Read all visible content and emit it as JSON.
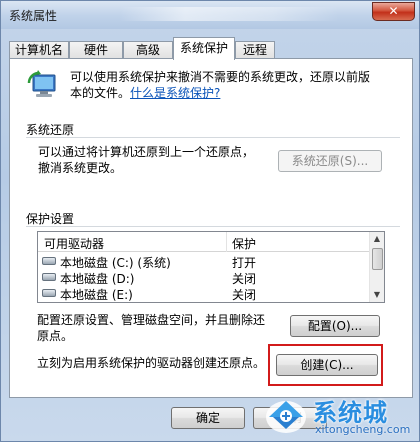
{
  "window": {
    "title": "系统属性",
    "close_label": "✕"
  },
  "tabs": [
    {
      "label": "计算机名"
    },
    {
      "label": "硬件"
    },
    {
      "label": "高级"
    },
    {
      "label": "系统保护"
    },
    {
      "label": "远程"
    }
  ],
  "intro": {
    "text_line1": "可以使用系统保护来撤消不需要的系统更改，还原以前版",
    "text_line2_prefix": "本的文件。",
    "link": "什么是系统保护?"
  },
  "restore": {
    "group_title": "系统还原",
    "desc_line1": "可以通过将计算机还原到上一个还原点，",
    "desc_line2": "撤消系统更改。",
    "button": "系统还原(S)..."
  },
  "protection": {
    "group_title": "保护设置",
    "columns": [
      "可用驱动器",
      "保护"
    ],
    "rows": [
      {
        "drive": "本地磁盘 (C:) (系统)",
        "protection": "打开"
      },
      {
        "drive": "本地磁盘 (D:)",
        "protection": "关闭"
      },
      {
        "drive": "本地磁盘 (E:)",
        "protection": "关闭"
      }
    ],
    "configure_desc_line1": "配置还原设置、管理磁盘空间，并且删除还",
    "configure_desc_line2": "原点。",
    "configure_button": "配置(O)...",
    "create_desc": "立刻为启用系统保护的驱动器创建还原点。",
    "create_button": "创建(C)..."
  },
  "footer": {
    "ok": "确定",
    "cancel": "取消"
  },
  "watermark": {
    "brand": "系统城",
    "url": "xitongcheng.com"
  },
  "icons": [
    "shield-computer-icon",
    "drive-icon",
    "scroll-up-icon",
    "scroll-down-icon",
    "watermark-logo-icon"
  ]
}
